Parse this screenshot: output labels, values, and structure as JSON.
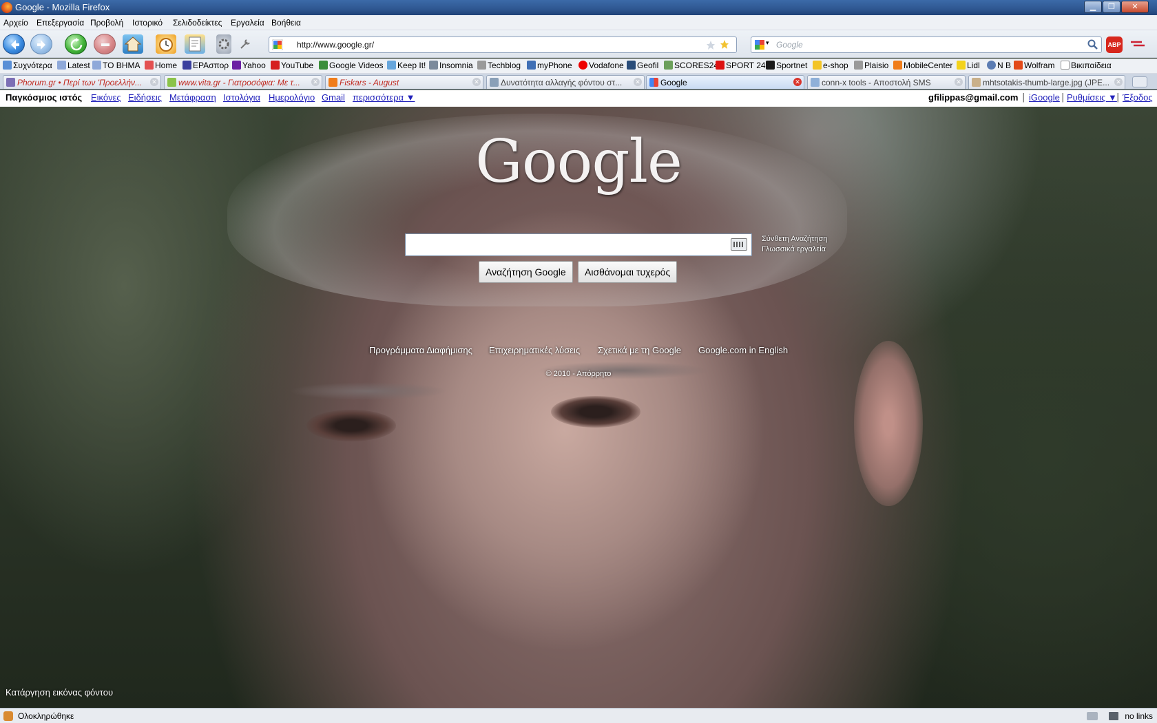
{
  "window": {
    "title": "Google - Mozilla Firefox"
  },
  "menu": [
    "Αρχείο",
    "Επεξεργασία",
    "Προβολή",
    "Ιστορικό",
    "Σελιδοδείκτες",
    "Εργαλεία",
    "Βοήθεια"
  ],
  "address": {
    "url": "http://www.google.gr/"
  },
  "search_engine": {
    "placeholder": "Google"
  },
  "addon": {
    "abp_label": "ABP"
  },
  "bookmarks": [
    "Συχνότερα",
    "Latest",
    "TO BHMA",
    "Home",
    "ΕΡΑσπορ",
    "Yahoo",
    "YouTube",
    "Google Videos",
    "Keep It!",
    "Insomnia",
    "Techblog",
    "myPhone",
    "Vodafone",
    "Geofil",
    "SCORES24",
    "SPORT 24",
    "Sportnet",
    "e-shop",
    "Plaisio",
    "MobileCenter",
    "Lidl",
    "N B",
    "Wolfram",
    "Βικιπαίδεια"
  ],
  "tabs": [
    {
      "label": "Phorum.gr • Περί των 'Προελλήν...",
      "active": false
    },
    {
      "label": "www.vita.gr - Γιατροσόφια: Με τ...",
      "active": false
    },
    {
      "label": "Fiskars - August",
      "active": false
    },
    {
      "label": "Δυνατότητα αλλαγής φόντου στ...",
      "active": false
    },
    {
      "label": "Google",
      "active": true
    },
    {
      "label": "conn-x tools - Αποστολή SMS",
      "active": false
    },
    {
      "label": "mhtsotakis-thumb-large.jpg (JPE...",
      "active": false
    }
  ],
  "gbar": {
    "links": [
      "Παγκόσμιος ιστός",
      "Εικόνες",
      "Ειδήσεις",
      "Μετάφραση",
      "Ιστολόγια",
      "Ημερολόγιο",
      "Gmail",
      "περισσότερα ▼"
    ],
    "user": "gfilippas@gmail.com",
    "igoogle": "iGoogle",
    "settings": "Ρυθμίσεις ▼",
    "signout": "Έξοδος"
  },
  "page": {
    "logo": "Google",
    "advanced_search": "Σύνθετη Αναζήτηση",
    "language_tools": "Γλωσσικά εργαλεία",
    "search_button": "Αναζήτηση Google",
    "lucky_button": "Αισθάνομαι τυχερός",
    "footer_links": [
      "Προγράμματα Διαφήμισης",
      "Επιχειρηματικές λύσεις",
      "Σχετικά με τη Google",
      "Google.com in English"
    ],
    "copyright": "© 2010 - Απόρρητο",
    "remove_bg": "Κατάργηση εικόνας φόντου"
  },
  "status": {
    "text": "Ολοκληρώθηκε",
    "right": "no links"
  },
  "colors": {
    "link": "#2222bb",
    "titlebar": "#2e5791"
  }
}
